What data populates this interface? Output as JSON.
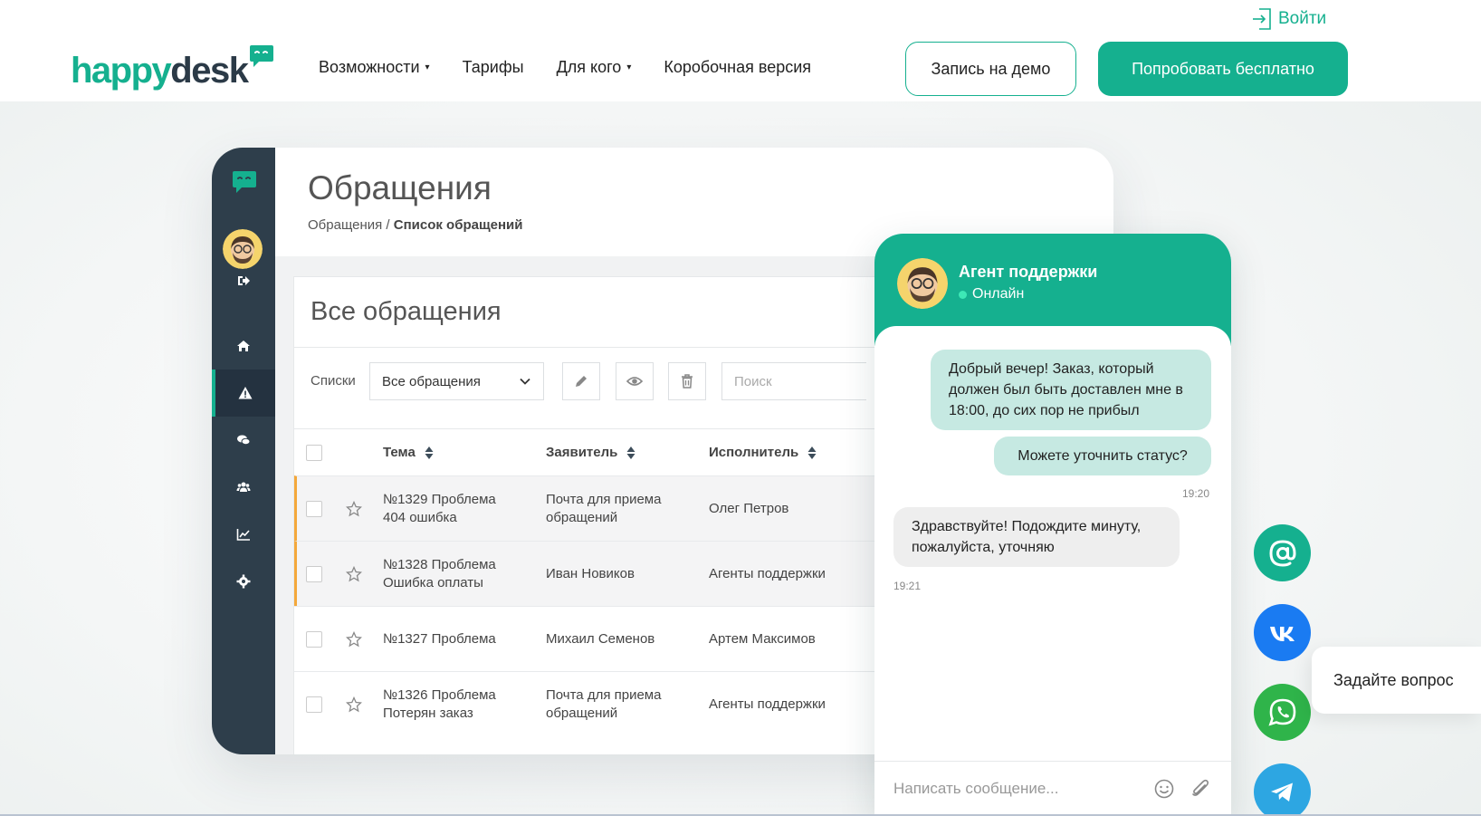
{
  "header": {
    "login_label": "Войти",
    "logo": {
      "part1": "happy",
      "part2": "desk"
    },
    "nav": [
      {
        "label": "Возможности",
        "caret": "▾"
      },
      {
        "label": "Тарифы",
        "caret": ""
      },
      {
        "label": "Для кого",
        "caret": "▾"
      },
      {
        "label": "Коробочная версия",
        "caret": ""
      }
    ],
    "demo_button": "Запись на демо",
    "try_button": "Попробовать бесплатно"
  },
  "colors": {
    "brand": "#15b08f",
    "dark": "#2e3e4b",
    "row_marker": "#f4a83b"
  },
  "app": {
    "page_title": "Обращения",
    "breadcrumb": {
      "parent": "Обращения",
      "separator": " / ",
      "current": "Список обращений"
    },
    "panel_title": "Все обращения",
    "lists_label": "Списки",
    "list_select_value": "Все обращения",
    "search_placeholder": "Поиск",
    "columns": {
      "subject": "Тема",
      "requester": "Заявитель",
      "assignee": "Исполнитель"
    },
    "rows": [
      {
        "subject": [
          "№1329 Проблема",
          "404 ошибка"
        ],
        "requester": [
          "Почта для приема",
          "обращений"
        ],
        "assignee": "Олег Петров"
      },
      {
        "subject": [
          "№1328 Проблема",
          "Ошибка оплаты"
        ],
        "requester": [
          "Иван Новиков"
        ],
        "assignee": "Агенты поддержки"
      },
      {
        "subject": [
          "№1327 Проблема"
        ],
        "requester": [
          "Михаил Семенов"
        ],
        "assignee": "Артем Максимов"
      },
      {
        "subject": [
          "№1326 Проблема",
          "Потерян заказ"
        ],
        "requester": [
          "Почта для приема",
          "обращений"
        ],
        "assignee": "Агенты поддержки"
      }
    ]
  },
  "chat": {
    "agent_name": "Агент поддержки",
    "agent_status": "Онлайн",
    "messages": [
      {
        "text": "Добрый вечер! Заказ, который должен был быть доставлен мне в 18:00, до сих пор не прибыл",
        "dir": "out"
      },
      {
        "text": "Можете уточнить статус?",
        "dir": "out",
        "time": "19:20"
      },
      {
        "text": "Здравствуйте! Подождите минуту, пожалуйста, уточняю",
        "dir": "in",
        "time": "19:21"
      }
    ],
    "input_placeholder": "Написать сообщение..."
  },
  "social": [
    {
      "icon": "email-icon",
      "color": "#15b08f"
    },
    {
      "icon": "vk-icon",
      "color": "#1a7bf2"
    },
    {
      "icon": "whatsapp-icon",
      "color": "#2fb44a"
    },
    {
      "icon": "telegram-icon",
      "color": "#2da6e2"
    }
  ],
  "ask_question": "Задайте вопрос"
}
